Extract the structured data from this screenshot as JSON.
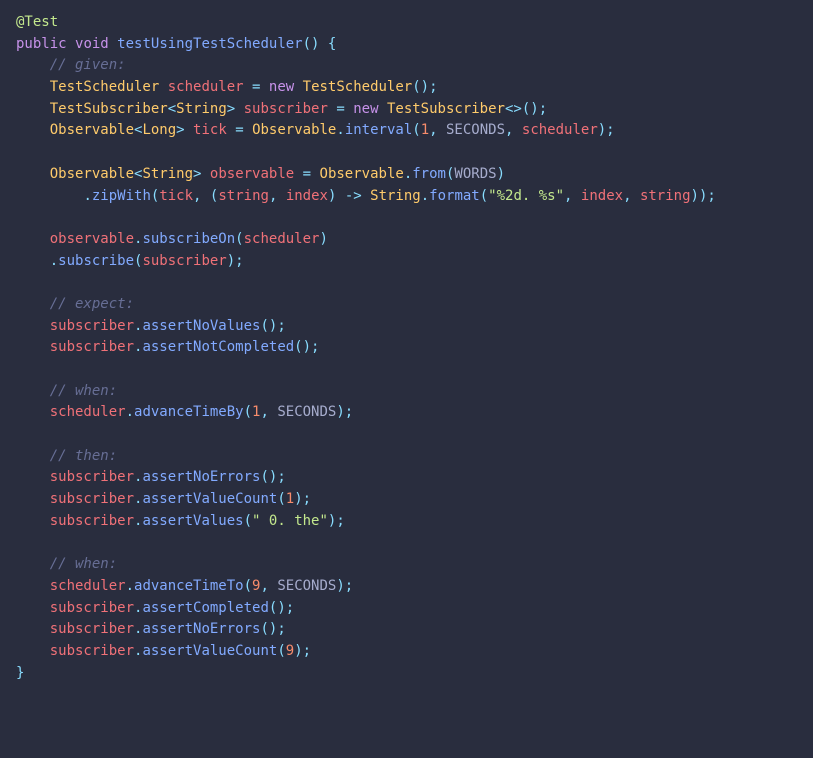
{
  "code": {
    "annotation": "@Test",
    "kw_public": "public",
    "kw_void": "void",
    "kw_new": "new",
    "method_name": "testUsingTestScheduler",
    "comment_given": "// given:",
    "comment_expect": "// expect:",
    "comment_when1": "// when:",
    "comment_then": "// then:",
    "comment_when2": "// when:",
    "type_TestScheduler": "TestScheduler",
    "type_TestSubscriber": "TestSubscriber",
    "type_String": "String",
    "type_Observable": "Observable",
    "type_Long": "Long",
    "var_scheduler": "scheduler",
    "var_subscriber": "subscriber",
    "var_tick": "tick",
    "var_observable": "observable",
    "var_string": "string",
    "var_index": "index",
    "method_interval": "interval",
    "method_from": "from",
    "method_zipWith": "zipWith",
    "method_format": "format",
    "method_subscribeOn": "subscribeOn",
    "method_subscribe": "subscribe",
    "method_assertNoValues": "assertNoValues",
    "method_assertNotCompleted": "assertNotCompleted",
    "method_advanceTimeBy": "advanceTimeBy",
    "method_assertNoErrors": "assertNoErrors",
    "method_assertValueCount": "assertValueCount",
    "method_assertValues": "assertValues",
    "method_advanceTimeTo": "advanceTimeTo",
    "method_assertCompleted": "assertCompleted",
    "const_SECONDS": "SECONDS",
    "const_WORDS": "WORDS",
    "num_1": "1",
    "num_9": "9",
    "str_format": "\"%2d. %s\"",
    "str_value": "\" 0. the\""
  }
}
